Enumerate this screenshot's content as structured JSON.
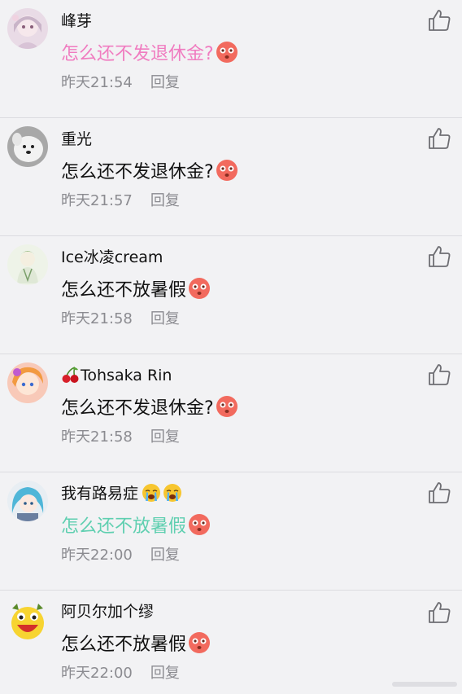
{
  "colors": {
    "background": "#f2f2f4",
    "pink": "#f07cc0",
    "teal": "#5fcfb0",
    "meta": "#8b8b90",
    "divider": "#dcdce0"
  },
  "comments": [
    {
      "name": "峰芽",
      "text": "怎么还不发退休金?",
      "emoji": "flushed-face",
      "time": "昨天21:54",
      "reply": "回复",
      "text_color": "#f07cc0"
    },
    {
      "name": "重光",
      "text": "怎么还不发退休金?",
      "emoji": "flushed-face",
      "time": "昨天21:57",
      "reply": "回复",
      "text_color": "#111111"
    },
    {
      "name": "Ice冰凌cream",
      "text": "怎么还不放暑假",
      "emoji": "flushed-face",
      "time": "昨天21:58",
      "reply": "回复",
      "text_color": "#111111"
    },
    {
      "name": "Tohsaka Rin",
      "name_prefix_emoji": "cherries",
      "text": "怎么还不发退休金?",
      "emoji": "flushed-face",
      "time": "昨天21:58",
      "reply": "回复",
      "text_color": "#111111"
    },
    {
      "name": "我有路易症",
      "name_suffix_emoji": "crying-face",
      "text": "怎么还不放暑假",
      "emoji": "flushed-face",
      "time": "昨天22:00",
      "reply": "回复",
      "text_color": "#5fcfb0"
    },
    {
      "name": "阿贝尔加个缪",
      "text": "怎么还不放暑假",
      "emoji": "flushed-face",
      "time": "昨天22:00",
      "reply": "回复",
      "text_color": "#111111"
    }
  ]
}
